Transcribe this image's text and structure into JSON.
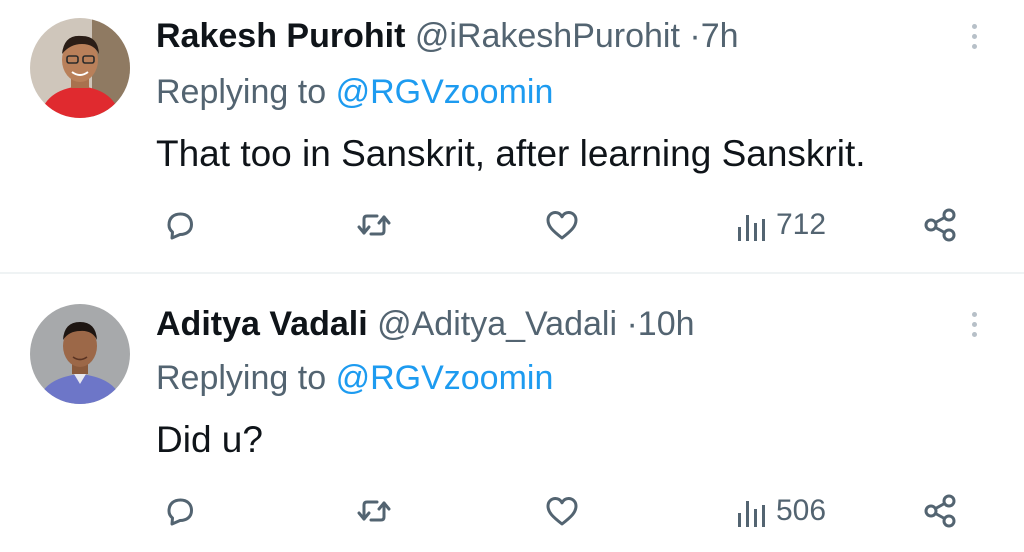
{
  "tweets": [
    {
      "name": "Rakesh Purohit",
      "handle": "@iRakeshPurohit",
      "separator": "·",
      "time": "7h",
      "replying_prefix": "Replying to",
      "replying_to": "@RGVzoomin",
      "text": "That too in Sanskrit, after learning Sanskrit.",
      "views": "712",
      "icons": [
        "reply-icon",
        "retweet-icon",
        "like-icon",
        "views-icon",
        "share-icon",
        "more-icon"
      ]
    },
    {
      "name": "Aditya Vadali",
      "handle": "@Aditya_Vadali",
      "separator": "·",
      "time": "10h",
      "replying_prefix": "Replying to",
      "replying_to": "@RGVzoomin",
      "text": "Did u?",
      "views": "506",
      "icons": [
        "reply-icon",
        "retweet-icon",
        "like-icon",
        "views-icon",
        "share-icon",
        "more-icon"
      ]
    }
  ],
  "colors": {
    "text_primary": "#0f1419",
    "text_secondary": "#536471",
    "mention": "#1d9bf0",
    "divider": "#eff3f4"
  }
}
